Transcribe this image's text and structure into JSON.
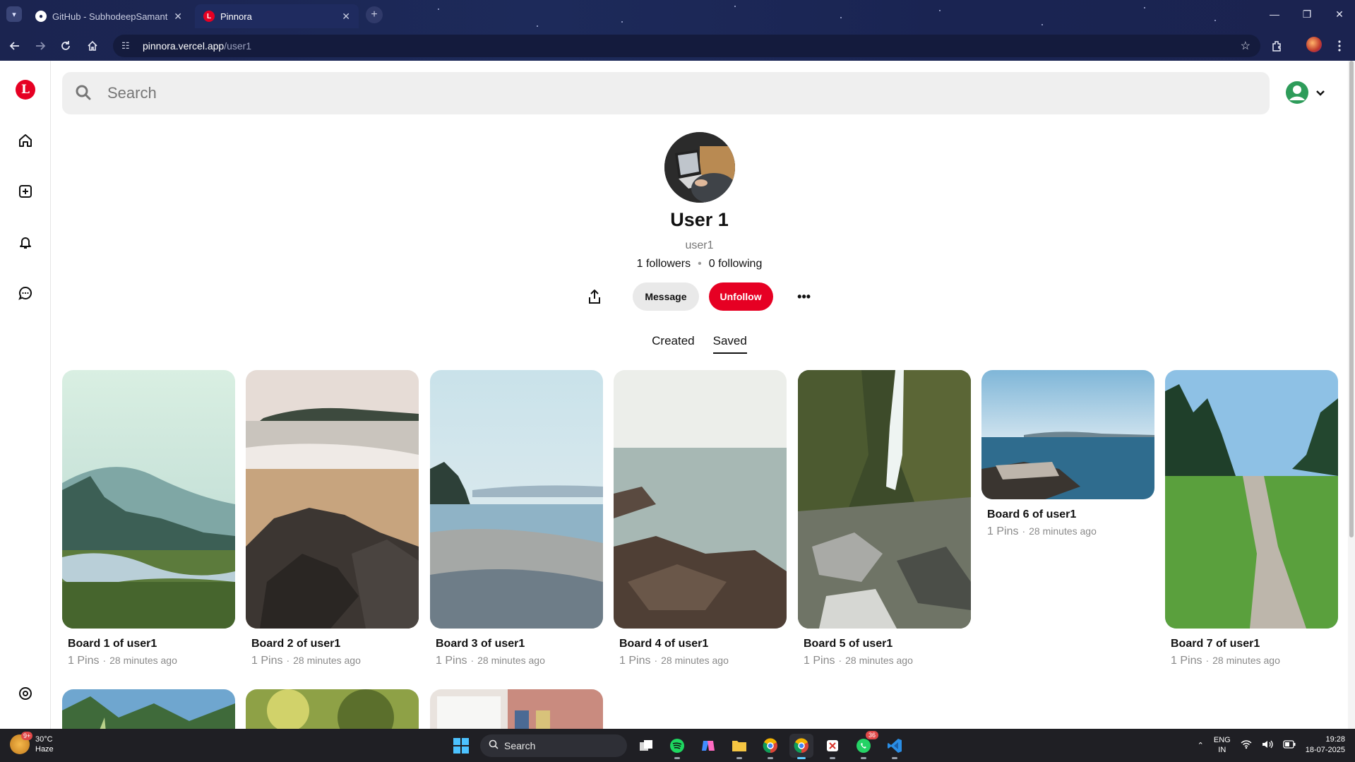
{
  "browser": {
    "tabs": [
      {
        "title": "GitHub - SubhodeepSamanta/P",
        "active": false
      },
      {
        "title": "Pinnora",
        "active": true
      }
    ],
    "url_host": "pinnora.vercel.app",
    "url_path": "/user1",
    "profile_icon": "avatar-circle"
  },
  "app": {
    "logo_letter": "L",
    "brand_color": "#e60023",
    "sidebar": [
      "home-icon",
      "add-icon",
      "bell-icon",
      "chat-icon",
      "settings-icon"
    ]
  },
  "search": {
    "placeholder": "Search"
  },
  "profile": {
    "name": "User 1",
    "username": "user1",
    "followers": "1 followers",
    "following": "0 following",
    "message_label": "Message",
    "unfollow_label": "Unfollow",
    "more_label": "•••"
  },
  "tabs": {
    "created": "Created",
    "saved": "Saved",
    "selected": "Saved"
  },
  "boards": [
    {
      "title": "Board 1 of user1",
      "pins": "1 Pins",
      "time": "28 minutes ago"
    },
    {
      "title": "Board 2 of user1",
      "pins": "1 Pins",
      "time": "28 minutes ago"
    },
    {
      "title": "Board 3 of user1",
      "pins": "1 Pins",
      "time": "28 minutes ago"
    },
    {
      "title": "Board 4 of user1",
      "pins": "1 Pins",
      "time": "28 minutes ago"
    },
    {
      "title": "Board 5 of user1",
      "pins": "1 Pins",
      "time": "28 minutes ago"
    },
    {
      "title": "Board 6 of user1",
      "pins": "1 Pins",
      "time": "28 minutes ago"
    },
    {
      "title": "Board 7 of user1",
      "pins": "1 Pins",
      "time": "28 minutes ago"
    }
  ],
  "taskbar": {
    "temp": "30°C",
    "weather": "Haze",
    "weather_badge": "9+",
    "search_label": "Search",
    "whatsapp_badge": "36",
    "lang_top": "ENG",
    "lang_bottom": "IN",
    "time": "19:28",
    "date": "18-07-2025"
  }
}
